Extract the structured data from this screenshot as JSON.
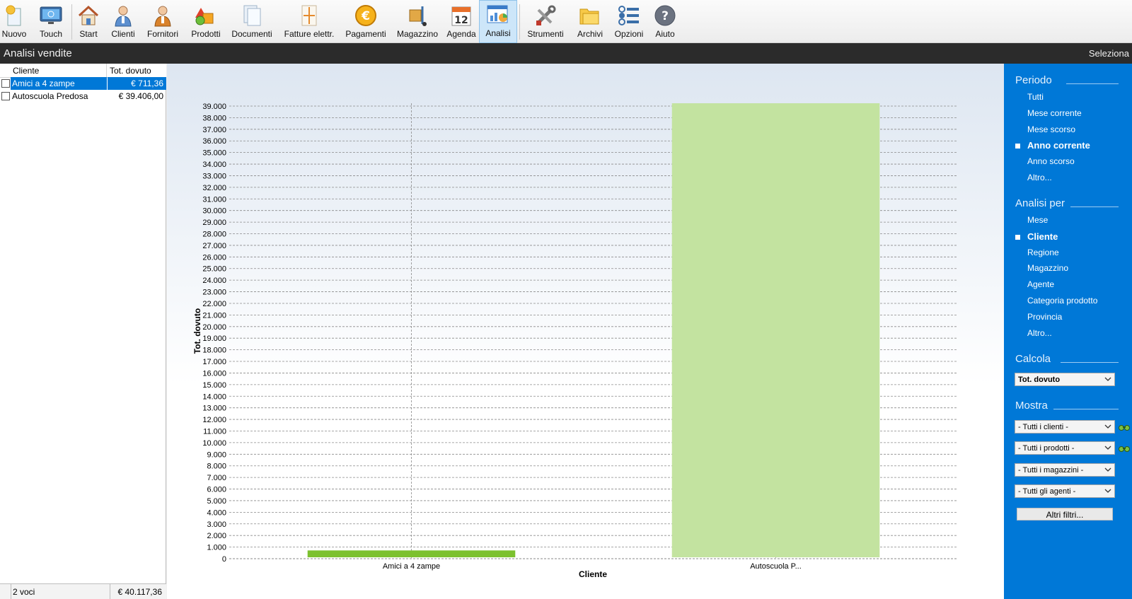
{
  "toolbar": {
    "items": [
      {
        "label": "Nuovo",
        "icon": "new-icon"
      },
      {
        "label": "Touch",
        "icon": "touch-monitor-icon"
      },
      {
        "label": "Start",
        "icon": "home-icon"
      },
      {
        "label": "Clienti",
        "icon": "client-person-icon"
      },
      {
        "label": "Fornitori",
        "icon": "supplier-person-icon"
      },
      {
        "label": "Prodotti",
        "icon": "products-shapes-icon"
      },
      {
        "label": "Documenti",
        "icon": "documents-icon"
      },
      {
        "label": "Fatture elettr.",
        "icon": "electronic-invoice-icon"
      },
      {
        "label": "Pagamenti",
        "icon": "euro-coin-icon"
      },
      {
        "label": "Magazzino",
        "icon": "warehouse-trolley-icon"
      },
      {
        "label": "Agenda",
        "icon": "calendar-icon",
        "calendar_day": "12"
      },
      {
        "label": "Analisi",
        "icon": "analysis-chart-icon"
      },
      {
        "label": "Strumenti",
        "icon": "tools-icon"
      },
      {
        "label": "Archivi",
        "icon": "archive-folders-icon"
      },
      {
        "label": "Opzioni",
        "icon": "options-list-icon"
      },
      {
        "label": "Aiuto",
        "icon": "help-icon"
      }
    ],
    "active": "Analisi"
  },
  "titlebar": {
    "title": "Analisi vendite",
    "action": "Seleziona"
  },
  "list": {
    "columns": [
      "Cliente",
      "Tot. dovuto"
    ],
    "rows": [
      {
        "name": "Amici a 4 zampe",
        "value": "€ 711,36",
        "selected": true
      },
      {
        "name": "Autoscuola Predosa",
        "value": "€ 39.406,00",
        "selected": false
      }
    ],
    "footer": {
      "count": "2 voci",
      "total": "€ 40.117,36"
    }
  },
  "chart_data": {
    "type": "bar",
    "categories": [
      "Amici a 4 zampe",
      "Autoscuola P..."
    ],
    "values": [
      711.36,
      39406.0
    ],
    "colors": [
      "#7cc12f",
      "#c3e3a0"
    ],
    "xlabel": "Cliente",
    "ylabel": "Tot. dovuto",
    "ylim": [
      0,
      39000
    ],
    "ytick_step": 1000,
    "ytick_labels": [
      "0",
      "1.000",
      "2.000",
      "3.000",
      "4.000",
      "5.000",
      "6.000",
      "7.000",
      "8.000",
      "9.000",
      "10.000",
      "11.000",
      "12.000",
      "13.000",
      "14.000",
      "15.000",
      "16.000",
      "17.000",
      "18.000",
      "19.000",
      "20.000",
      "21.000",
      "22.000",
      "23.000",
      "24.000",
      "25.000",
      "26.000",
      "27.000",
      "28.000",
      "29.000",
      "30.000",
      "31.000",
      "32.000",
      "33.000",
      "34.000",
      "35.000",
      "36.000",
      "37.000",
      "38.000",
      "39.000"
    ],
    "grid": true
  },
  "rightpanel": {
    "periodo": {
      "title": "Periodo",
      "items": [
        "Tutti",
        "Mese corrente",
        "Mese scorso",
        "Anno corrente",
        "Anno scorso",
        "Altro..."
      ],
      "selected": "Anno corrente"
    },
    "analisi_per": {
      "title": "Analisi per",
      "items": [
        "Mese",
        "Cliente",
        "Regione",
        "Magazzino",
        "Agente",
        "Categoria prodotto",
        "Provincia",
        "Altro..."
      ],
      "selected": "Cliente"
    },
    "calcola": {
      "title": "Calcola",
      "value": "Tot. dovuto"
    },
    "mostra": {
      "title": "Mostra",
      "selects": [
        "- Tutti i clienti -",
        "- Tutti i prodotti -",
        "- Tutti i magazzini -",
        "- Tutti gli agenti -"
      ],
      "button": "Altri filtri..."
    }
  }
}
